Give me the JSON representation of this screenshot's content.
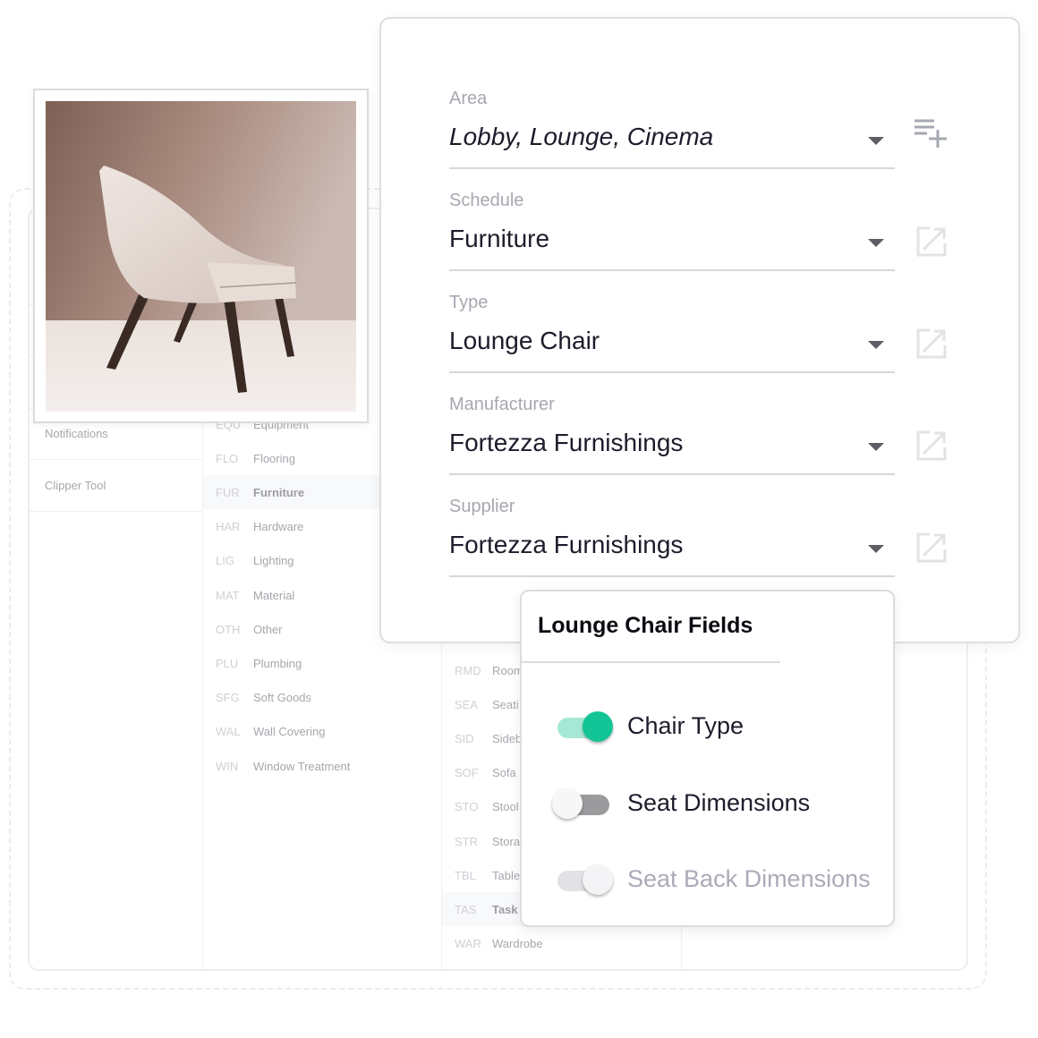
{
  "background": {
    "left_items": [
      "Notifications",
      "Clipper Tool"
    ],
    "categories": [
      {
        "code": "EQU",
        "name": "Equipment"
      },
      {
        "code": "FLO",
        "name": "Flooring"
      },
      {
        "code": "FUR",
        "name": "Furniture",
        "selected": true
      },
      {
        "code": "HAR",
        "name": "Hardware"
      },
      {
        "code": "LIG",
        "name": "Lighting"
      },
      {
        "code": "MAT",
        "name": "Material"
      },
      {
        "code": "OTH",
        "name": "Other"
      },
      {
        "code": "PLU",
        "name": "Plumbing"
      },
      {
        "code": "SFG",
        "name": "Soft Goods"
      },
      {
        "code": "WAL",
        "name": "Wall Covering"
      },
      {
        "code": "WIN",
        "name": "Window Treatment"
      }
    ],
    "types": [
      {
        "code": "RMD",
        "name": "Room"
      },
      {
        "code": "SEA",
        "name": "Seati"
      },
      {
        "code": "SID",
        "name": "Sideb"
      },
      {
        "code": "SOF",
        "name": "Sofa"
      },
      {
        "code": "STO",
        "name": "Stool"
      },
      {
        "code": "STR",
        "name": "Stora"
      },
      {
        "code": "TBL",
        "name": "Table"
      },
      {
        "code": "TAS",
        "name": "Task",
        "selected": true
      },
      {
        "code": "WAR",
        "name": "Wardrobe"
      }
    ]
  },
  "fields": [
    {
      "label": "Area",
      "value": "Lobby, Lounge, Cinema",
      "italic": true,
      "icon": "playlist-add-icon"
    },
    {
      "label": "Schedule",
      "value": "Furniture",
      "icon": "open-in-new-icon"
    },
    {
      "label": "Type",
      "value": "Lounge Chair",
      "icon": "open-in-new-icon"
    },
    {
      "label": "Manufacturer",
      "value": "Fortezza Furnishings",
      "icon": "open-in-new-icon"
    },
    {
      "label": "Supplier",
      "value": "Fortezza Furnishings",
      "icon": "open-in-new-icon"
    }
  ],
  "popup": {
    "title": "Lounge Chair Fields",
    "toggles": [
      {
        "label": "Chair Type",
        "on": true,
        "disabled": false
      },
      {
        "label": "Seat Dimensions",
        "on": false,
        "disabled": false
      },
      {
        "label": "Seat Back Dimensions",
        "on": true,
        "disabled": true
      }
    ]
  },
  "colors": {
    "accent": "#13c596",
    "accent_track": "#a6e8d6",
    "text": "#1c1d2b",
    "muted": "#a6a8b0"
  }
}
